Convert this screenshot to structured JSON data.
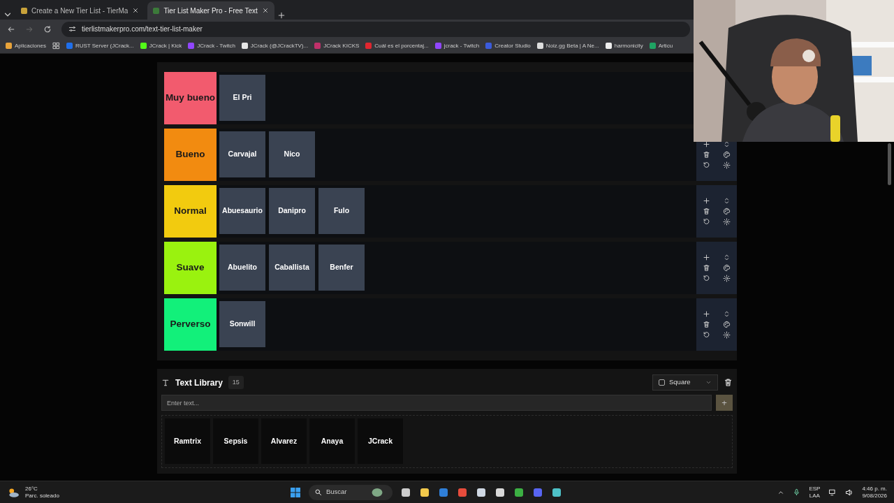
{
  "browser": {
    "tabs": [
      {
        "title": "Create a New Tier List - TierMa",
        "selected": false
      },
      {
        "title": "Tier List Maker Pro - Free Text",
        "selected": true
      }
    ],
    "url": "tierlistmakerpro.com/text-tier-list-maker",
    "bookmarks": [
      {
        "label": "Aplicaciones",
        "color": "#e8a33a"
      },
      {
        "label": "RUST Server (JCrack...",
        "color": "#1f6feb"
      },
      {
        "label": "JCrack | Kick",
        "color": "#53fc18"
      },
      {
        "label": "JCrack - Twitch",
        "color": "#9146ff"
      },
      {
        "label": "JCrack (@JCrackTV)...",
        "color": "#e6e6e6"
      },
      {
        "label": "JCrack KICKS",
        "color": "#c0306a"
      },
      {
        "label": "Cuál es el porcentaj...",
        "color": "#e0262f"
      },
      {
        "label": "jcrack - Twitch",
        "color": "#9146ff"
      },
      {
        "label": "Creator Studio",
        "color": "#3b5bdb"
      },
      {
        "label": "Noiz.gg Beta | A Ne...",
        "color": "#dddddd"
      },
      {
        "label": "harmonicity",
        "color": "#eeeeee"
      },
      {
        "label": "Articu",
        "color": "#1fa463"
      }
    ]
  },
  "tiers": [
    {
      "label": "Muy bueno",
      "color": "#f25b6e",
      "items": [
        "El Pri"
      ]
    },
    {
      "label": "Bueno",
      "color": "#f28b10",
      "items": [
        "Carvajal",
        "Nico"
      ]
    },
    {
      "label": "Normal",
      "color": "#f2cb0f",
      "items": [
        "Abuesaurio",
        "Danipro",
        "Fulo"
      ]
    },
    {
      "label": "Suave",
      "color": "#9af20f",
      "items": [
        "Abuelito",
        "Caballista",
        "Benfer"
      ]
    },
    {
      "label": "Perverso",
      "color": "#12f07a",
      "items": [
        "Sonwill"
      ]
    }
  ],
  "library": {
    "title": "Text Library",
    "count": "15",
    "shape": "Square",
    "shape_checked": false,
    "placeholder": "Enter text...",
    "add": "+",
    "items": [
      "Ramtrix",
      "Sepsis",
      "Alvarez",
      "Anaya",
      "JCrack"
    ]
  },
  "taskbar": {
    "temperature": "26°C",
    "weather": "Parc. soleado",
    "search_placeholder": "Buscar",
    "lang": "ESP",
    "layout": "LAA",
    "time": "4:46 p. m.",
    "date": "9/08/2026"
  }
}
